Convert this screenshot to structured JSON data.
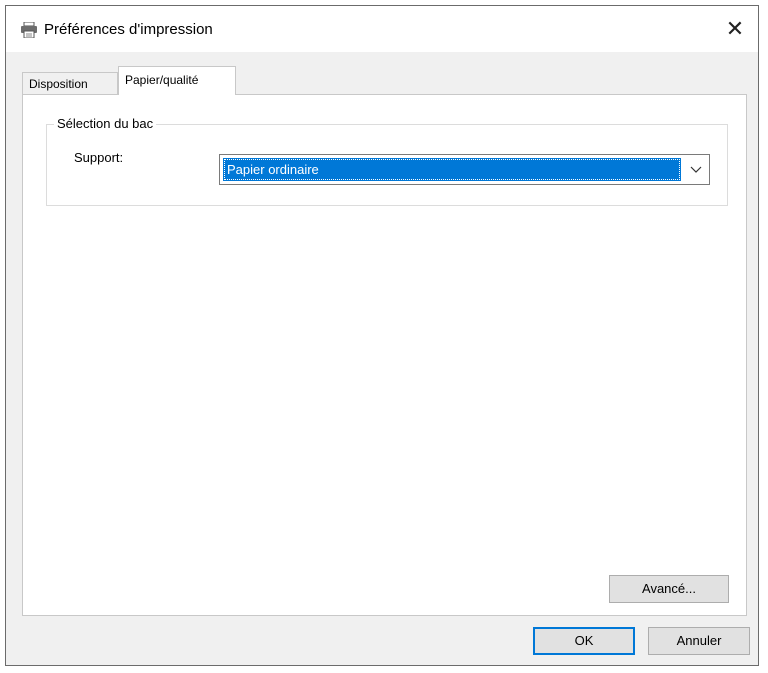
{
  "window": {
    "title": "Préférences d'impression",
    "close_icon": "close-icon",
    "app_icon": "printer-icon"
  },
  "tabs": [
    {
      "label": "Disposition",
      "active": false
    },
    {
      "label": "Papier/qualité",
      "active": true
    }
  ],
  "tray_selection": {
    "group_label": "Sélection du bac",
    "support_label": "Support:",
    "support_value": "Papier ordinaire"
  },
  "buttons": {
    "advanced": "Avancé...",
    "ok": "OK",
    "cancel": "Annuler"
  },
  "colors": {
    "selection": "#0078d7",
    "window_bg": "#f0f0f0"
  }
}
